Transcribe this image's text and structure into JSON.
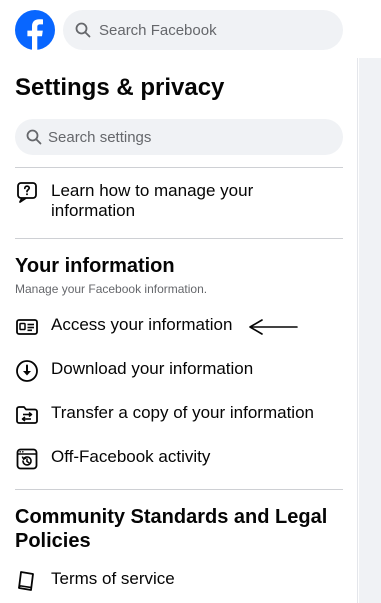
{
  "header": {
    "search_placeholder": "Search Facebook"
  },
  "settings": {
    "title": "Settings & privacy",
    "search_placeholder": "Search settings",
    "learn_item": "Learn how to manage your information",
    "your_information": {
      "title": "Your information",
      "subtitle": "Manage your Facebook information.",
      "items": [
        {
          "label": "Access your information",
          "icon": "id-card-icon"
        },
        {
          "label": "Download your information",
          "icon": "download-icon"
        },
        {
          "label": "Transfer a copy of your information",
          "icon": "transfer-folder-icon"
        },
        {
          "label": "Off-Facebook activity",
          "icon": "history-icon"
        }
      ]
    },
    "community": {
      "title": "Community Standards and Legal Policies",
      "items": [
        {
          "label": "Terms of service",
          "icon": "book-icon"
        }
      ]
    }
  },
  "colors": {
    "brand_blue": "#0866ff",
    "search_bg": "#f0f2f5",
    "secondary_text": "#65676b"
  }
}
